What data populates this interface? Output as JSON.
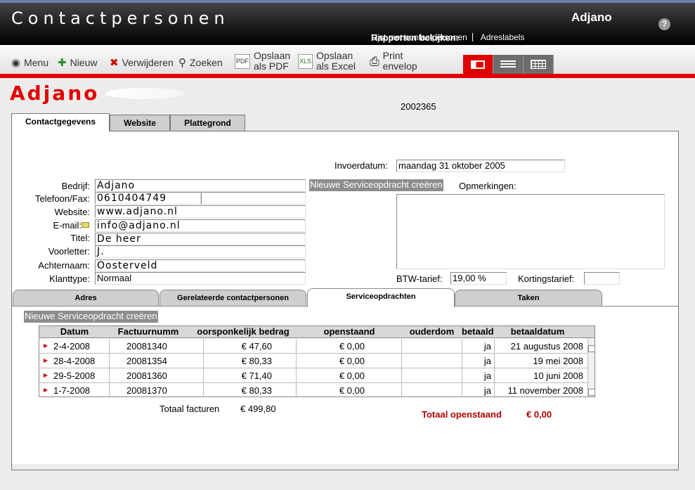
{
  "header": {
    "app_title": "Contactpersonen",
    "company": "Adjano",
    "help": "?",
    "reports_label": "Rapporten bekijken:",
    "reports": [
      "Lijst met contactpersonen",
      "Adreslabels"
    ]
  },
  "toolbar": {
    "menu": "Menu",
    "new": "Nieuw",
    "delete": "Verwijderen",
    "search": "Zoeken",
    "save_pdf_1": "Opslaan",
    "save_pdf_2": "als PDF",
    "save_xls_1": "Opslaan",
    "save_xls_2": "als Excel",
    "print_1": "Print",
    "print_2": "envelop"
  },
  "record": {
    "logo_text": "Adjano",
    "id": "2002365"
  },
  "tabs": [
    "Contactgegevens",
    "Website",
    "Plattegrond"
  ],
  "form": {
    "entry_date_label": "Invoerdatum:",
    "entry_date": "maandag 31 oktober 2005",
    "company_label": "Bedrijf:",
    "company": "Adjano",
    "phone_label": "Telefoon/Fax:",
    "phone": "0610404749",
    "fax": "",
    "website_label": "Website:",
    "website": "www.adjano.nl",
    "email_label": "E-mail:",
    "email": "info@adjano.nl",
    "title_label": "Titel:",
    "title": "De heer",
    "initials_label": "Voorletter:",
    "initials": "J.",
    "lastname_label": "Achternaam:",
    "lastname": "Oosterveld",
    "clienttype_label": "Klanttype:",
    "clienttype": "Normaal",
    "new_service_btn": "Nieuwe Serviceopdracht creëren",
    "remarks_label": "Opmerkingen:",
    "remarks": "",
    "vat_label": "BTW-tarief:",
    "vat": "19,00 %",
    "discount_label": "Kortingstarief:",
    "discount": ""
  },
  "subtabs": [
    "Adres",
    "Gerelateerde contactpersonen",
    "Serviceopdrachten",
    "Taken"
  ],
  "service": {
    "new_btn": "Nieuwe Serviceopdracht creëren",
    "columns": [
      "Datum",
      "Factuurnumm",
      "oorsponkelijk bedrag",
      "openstaand",
      "ouderdom",
      "betaald",
      "betaaldatum"
    ],
    "rows": [
      [
        "2-4-2008",
        "20081340",
        "€ 47,60",
        "€ 0,00",
        "",
        "ja",
        "21 augustus 2008"
      ],
      [
        "28-4-2008",
        "20081354",
        "€ 80,33",
        "€ 0,00",
        "",
        "ja",
        "19 mei 2008"
      ],
      [
        "29-5-2008",
        "20081360",
        "€ 71,40",
        "€ 0,00",
        "",
        "ja",
        "10 juni 2008"
      ],
      [
        "1-7-2008",
        "20081370",
        "€ 80,33",
        "€ 0,00",
        "",
        "ja",
        "11 november 2008"
      ]
    ],
    "total_invoices_label": "Totaal facturen",
    "total_invoices": "€ 499,80",
    "total_open_label": "Totaal openstaand",
    "total_open": "€ 0,00"
  },
  "colors": {
    "accent": "#e00000",
    "header_bg": "#000000"
  }
}
